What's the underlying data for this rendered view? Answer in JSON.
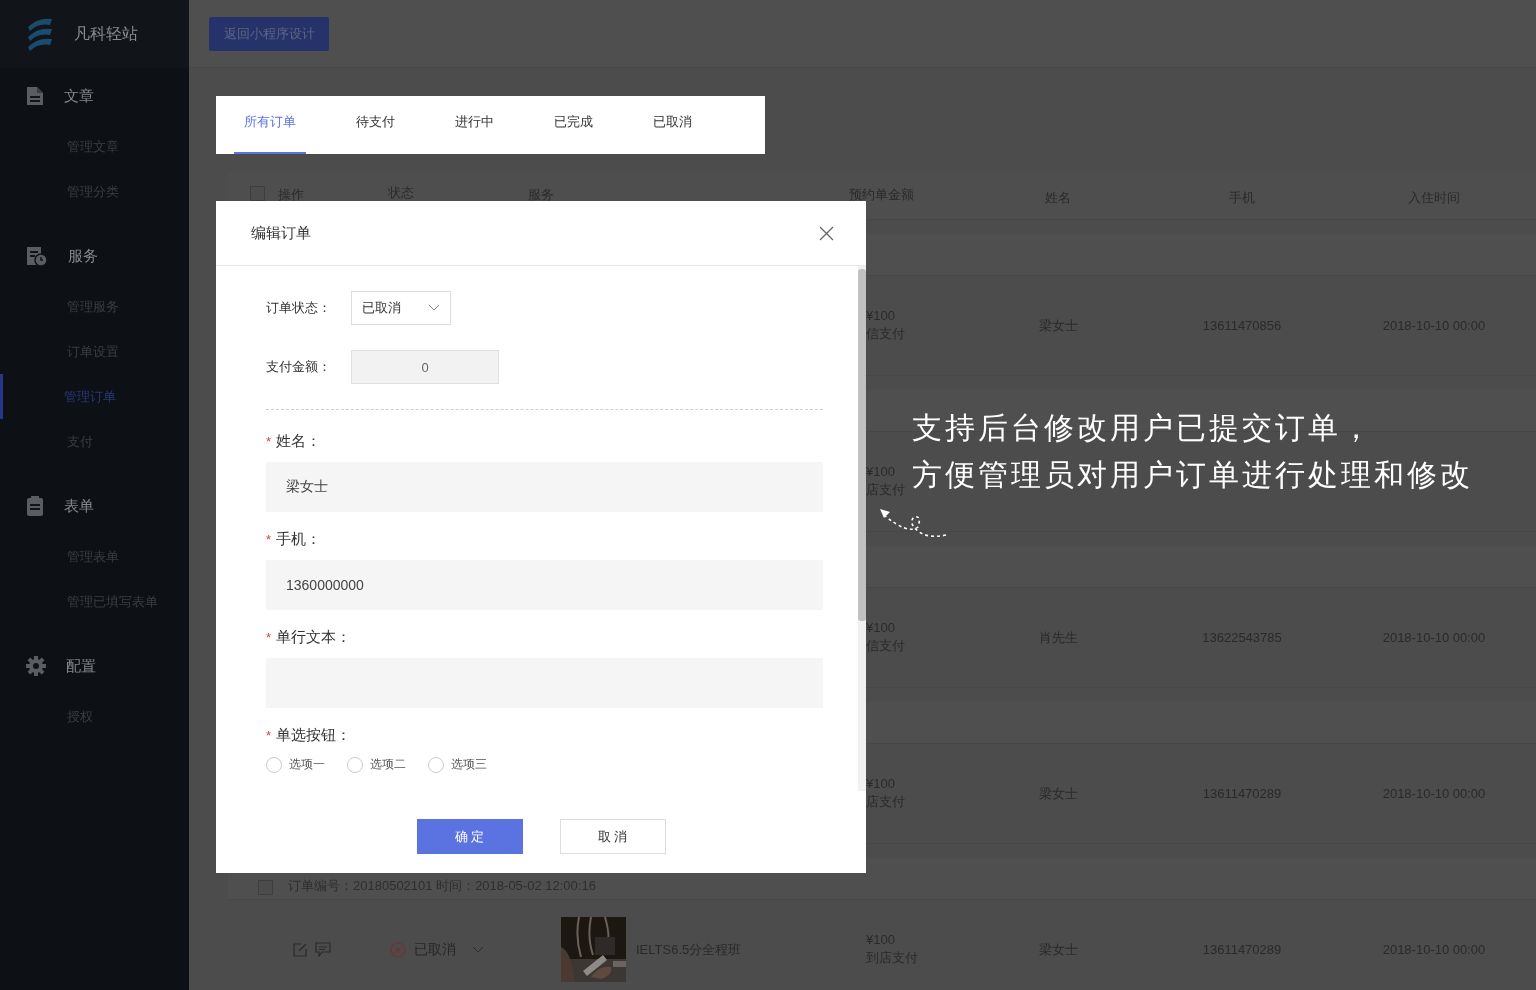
{
  "sidebar": {
    "logo_text": "凡科轻站",
    "sections": [
      {
        "title": "文章",
        "items": [
          {
            "label": "管理文章",
            "selected": false
          },
          {
            "label": "管理分类",
            "selected": false
          }
        ]
      },
      {
        "title": "服务",
        "items": [
          {
            "label": "管理服务",
            "selected": false
          },
          {
            "label": "订单设置",
            "selected": false
          },
          {
            "label": "管理订单",
            "selected": true
          },
          {
            "label": "支付",
            "selected": false
          }
        ]
      },
      {
        "title": "表单",
        "items": [
          {
            "label": "管理表单",
            "selected": false
          },
          {
            "label": "管理已填写表单",
            "selected": false
          }
        ]
      },
      {
        "title": "配置",
        "items": [
          {
            "label": "授权",
            "selected": false
          }
        ]
      }
    ]
  },
  "top_button": "返回小程序设计",
  "tabs": [
    {
      "label": "所有订单",
      "selected": true
    },
    {
      "label": "待支付",
      "selected": false
    },
    {
      "label": "进行中",
      "selected": false
    },
    {
      "label": "已完成",
      "selected": false
    },
    {
      "label": "已取消",
      "selected": false
    }
  ],
  "table": {
    "select_all_checked": false,
    "columns": [
      "操作",
      "状态",
      "服务",
      "预约单金额",
      "姓名",
      "手机",
      "入住时间"
    ],
    "rows": [
      {
        "amount": "¥100",
        "payment": "信支付",
        "name": "梁女士",
        "phone": "13611470856",
        "time": "2018-10-10 00:00"
      },
      {
        "amount": "¥100",
        "payment": "店支付"
      },
      {
        "amount": "¥100",
        "payment": "信支付",
        "name": "肖先生",
        "phone": "13622543785",
        "time": "2018-10-10 00:00"
      },
      {
        "amount": "¥100",
        "payment": "店支付",
        "name": "梁女士",
        "phone": "13611470289",
        "time": "2018-10-10 00:00"
      },
      {
        "checked": false,
        "order_info": "订单编号：20180502101   时间：2018-05-02 12:00:16",
        "status": "已取消",
        "service": "IELTS6.5分全程班",
        "amount": "¥100",
        "payment": "到店支付",
        "name": "梁女士",
        "phone": "13611470289",
        "time": "2018-10-10 00:00"
      }
    ]
  },
  "dialog": {
    "title": "编辑订单",
    "status_fields": [
      {
        "kind": "select",
        "label": "订单状态：",
        "value": "已取消"
      },
      {
        "kind": "readonly",
        "label": "支付金额：",
        "value": "0"
      }
    ],
    "form_fields": [
      {
        "kind": "text",
        "mark": "*",
        "label": "姓名：",
        "value": "梁女士"
      },
      {
        "kind": "text",
        "mark": "*",
        "label": "手机：",
        "value": "1360000000"
      },
      {
        "kind": "text",
        "mark": "*",
        "label": "单行文本："
      },
      {
        "kind": "radio",
        "mark": "*",
        "label": "单选按钮：",
        "options": [
          {
            "label": "选项一",
            "selected": false
          },
          {
            "label": "选项二",
            "selected": false
          },
          {
            "label": "选项三",
            "selected": false
          }
        ]
      }
    ],
    "buttons": [
      {
        "label": "确 定",
        "primary": true
      },
      {
        "label": "取 消",
        "primary": false
      }
    ]
  },
  "annotation": {
    "lines": [
      "支持后台修改用户已提交订单，",
      "方便管理员对用户订单进行处理和修改"
    ]
  }
}
